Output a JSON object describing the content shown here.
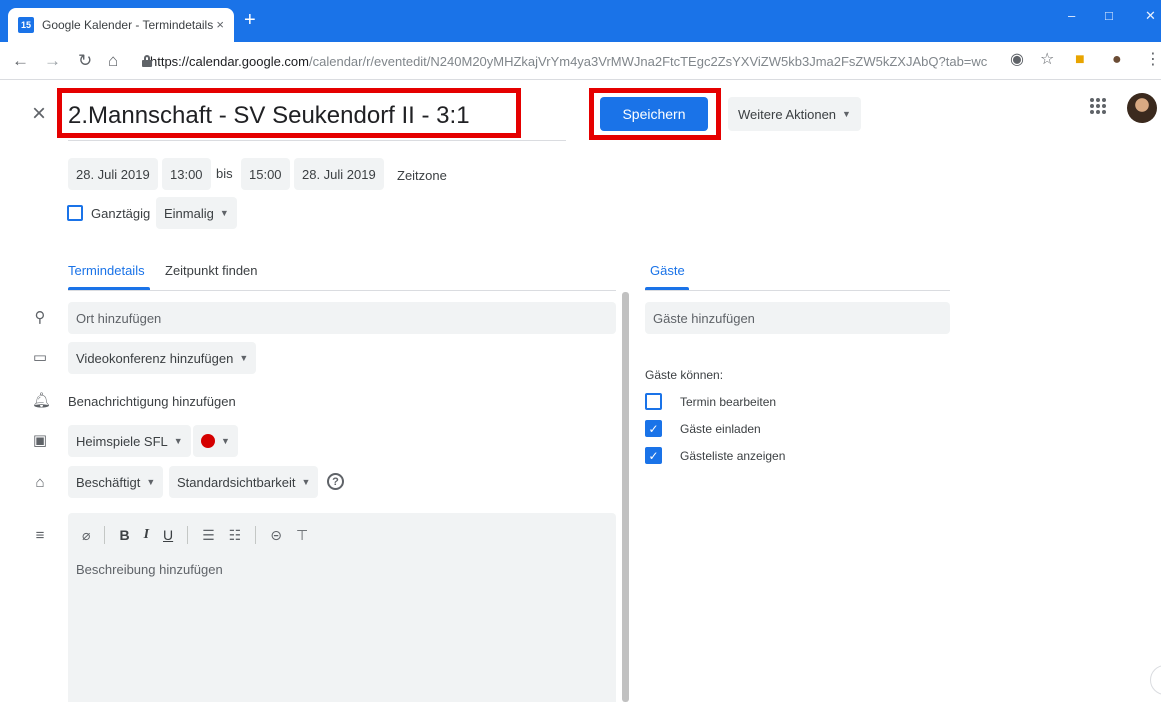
{
  "browser": {
    "tab_title": "Google Kalender - Termindetails",
    "favicon_text": "15",
    "tab_close": "×",
    "new_tab": "+",
    "url_host": "https://calendar.google.com",
    "url_path": "/calendar/r/eventedit/N240M20yMHZkajVrYm4ya3VrMWJna2FtcTEgc2ZsYXViZW5kb3Jma2FsZW5kZXJAbQ?tab=wc",
    "minimize": "–",
    "maximize": "□",
    "close": "✕"
  },
  "event": {
    "close_symbol": "×",
    "title": "2.Mannschaft - SV Seukendorf II - 3:1",
    "save_label": "Speichern",
    "more_actions_label": "Weitere Aktionen",
    "start_date": "28. Juli 2019",
    "start_time": "13:00",
    "to_label": "bis",
    "end_time": "15:00",
    "end_date": "28. Juli 2019",
    "timezone_label": "Zeitzone",
    "allday_label": "Ganztägig",
    "recurrence_label": "Einmalig"
  },
  "tabs": {
    "details": "Termindetails",
    "find_time": "Zeitpunkt finden",
    "guests": "Gäste"
  },
  "details": {
    "location_placeholder": "Ort hinzufügen",
    "video_label": "Videokonferenz hinzufügen",
    "notification_label": "Benachrichtigung hinzufügen",
    "calendar_name": "Heimspiele SFL",
    "event_color": "#d50000",
    "availability": "Beschäftigt",
    "visibility": "Standardsichtbarkeit",
    "help_symbol": "?",
    "description_placeholder": "Beschreibung hinzufügen"
  },
  "guests": {
    "add_placeholder": "Gäste hinzufügen",
    "can_label": "Gäste können:",
    "permissions": [
      {
        "label": "Termin bearbeiten",
        "checked": false
      },
      {
        "label": "Gäste einladen",
        "checked": true
      },
      {
        "label": "Gästeliste anzeigen",
        "checked": true
      }
    ]
  },
  "colors": {
    "accent": "#1a73e8",
    "highlight_border": "#e50000"
  }
}
